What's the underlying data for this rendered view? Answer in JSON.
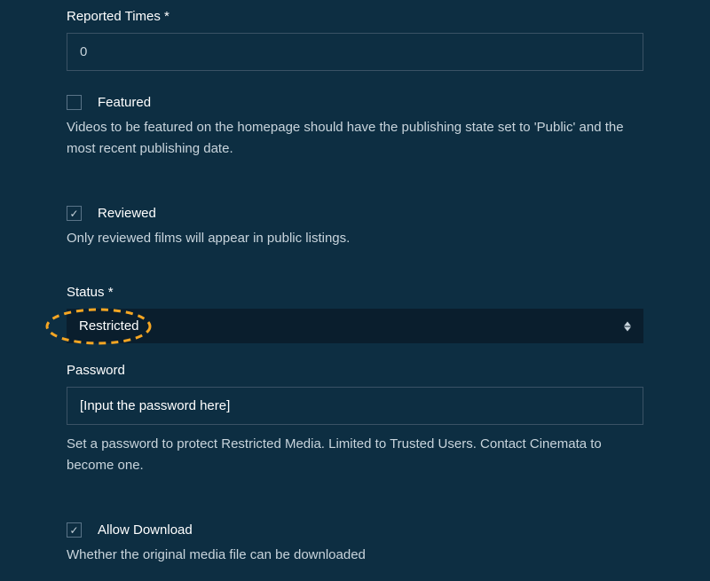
{
  "reportedTimes": {
    "label": "Reported Times *",
    "value": "0"
  },
  "featured": {
    "label": "Featured",
    "checked": false,
    "hint": "Videos to be featured on the homepage should have the publishing state set to 'Public' and the most recent publishing date."
  },
  "reviewed": {
    "label": "Reviewed",
    "checked": true,
    "hint": "Only reviewed films will appear in public listings."
  },
  "status": {
    "label": "Status *",
    "value": "Restricted"
  },
  "password": {
    "label": "Password",
    "placeholder": "[Input the password here]",
    "hint": "Set a password to protect Restricted Media. Limited to Trusted Users. Contact Cinemata to become one."
  },
  "allowDownload": {
    "label": "Allow Download",
    "checked": true,
    "hint": "Whether the original media file can be downloaded"
  }
}
